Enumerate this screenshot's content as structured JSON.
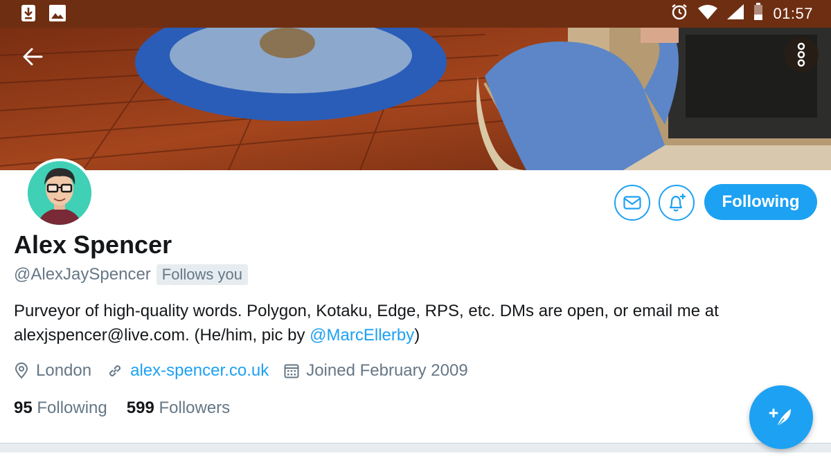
{
  "status_bar": {
    "time": "01:57",
    "left_icons": [
      "download-icon",
      "image-icon"
    ],
    "right_icons": [
      "alarm-icon",
      "wifi-icon",
      "signal-icon",
      "battery-icon"
    ]
  },
  "header": {
    "back_icon": "arrow-left-icon",
    "more_icon": "more-vertical-icon"
  },
  "profile": {
    "name": "Alex Spencer",
    "handle": "@AlexJaySpencer",
    "follows_you": "Follows you",
    "bio_text": "Purveyor of high-quality words. Polygon, Kotaku, Edge, RPS, etc. DMs are open, or email me at alexjspencer@live.com. (He/him, pic by ",
    "bio_mention": "@MarcEllerby",
    "bio_end": ")",
    "location": "London",
    "website": "alex-spencer.co.uk",
    "joined": "Joined February 2009",
    "following_count": "95",
    "following_label": "Following",
    "followers_count": "599",
    "followers_label": "Followers"
  },
  "actions": {
    "dm_icon": "envelope-icon",
    "notify_icon": "bell-plus-icon",
    "following_button": "Following",
    "compose_icon": "compose-tweet-icon"
  },
  "colors": {
    "accent": "#1da1f2",
    "status_bar": "#6e2e12",
    "text_primary": "#14171a",
    "text_secondary": "#657786"
  }
}
